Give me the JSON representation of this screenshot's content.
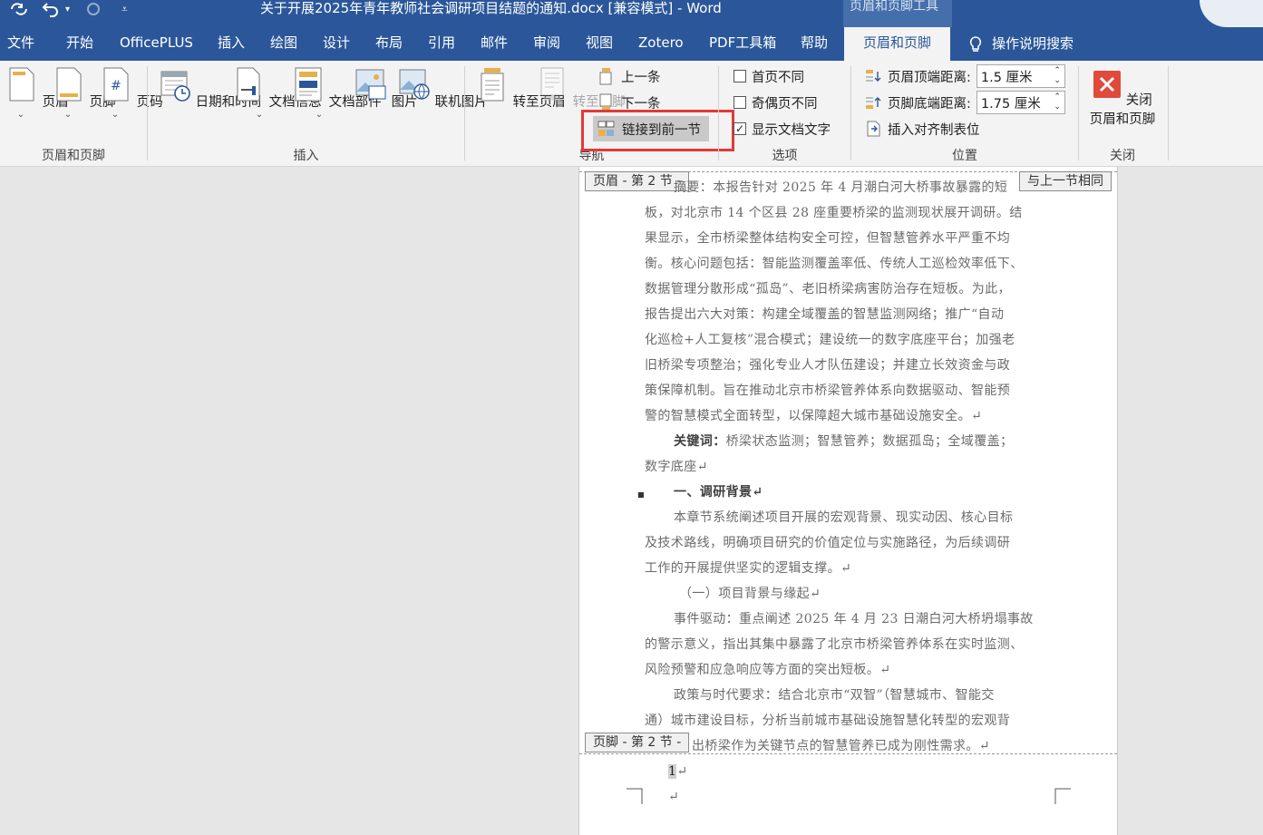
{
  "titlebar": {
    "title": "关于开展2025年青年教师社会调研项目结题的通知.docx [兼容模式]  -  Word",
    "contextual_tools": "页眉和页脚工具"
  },
  "tabs": [
    "文件",
    "开始",
    "OfficePLUS",
    "插入",
    "绘图",
    "设计",
    "布局",
    "引用",
    "邮件",
    "审阅",
    "视图",
    "Zotero",
    "PDF工具箱",
    "帮助",
    "页眉和页脚"
  ],
  "search_label": "操作说明搜索",
  "ribbon": {
    "hf_group": {
      "label": "页眉和页脚",
      "header": "页眉",
      "footer": "页脚",
      "page_number": "页码"
    },
    "insert_group": {
      "label": "插入",
      "datetime": "日期和时间",
      "docinfo": "文档信息",
      "docparts": "文档部件",
      "picture": "图片",
      "online_picture": "联机图片"
    },
    "nav_group": {
      "label": "导航",
      "goto_header": "转至页眉",
      "goto_footer": "转至页脚",
      "previous": "上一条",
      "next": "下一条",
      "link_previous": "链接到前一节"
    },
    "options_group": {
      "label": "选项",
      "different_first": "首页不同",
      "different_odd_even": "奇偶页不同",
      "show_doc_text": "显示文档文字"
    },
    "position_group": {
      "label": "位置",
      "header_from_top_label": "页眉顶端距离:",
      "header_from_top_value": "1.5 厘米",
      "footer_from_bottom_label": "页脚底端距离:",
      "footer_from_bottom_value": "1.75 厘米",
      "insert_align_tab": "插入对齐制表位"
    },
    "close_group": {
      "label": "关闭",
      "close_line1": "关闭",
      "close_line2": "页眉和页脚"
    }
  },
  "document": {
    "header_tag": "页眉 - 第 2 节 -",
    "same_as_previous": "与上一节相同",
    "footer_tag": "页脚 - 第 2 节 -",
    "page_number": "1",
    "lines": [
      "摘要：本报告针对 2025 年 4 月潮白河大桥事故暴露的短",
      "板，对北京市 14 个区县 28 座重要桥梁的监测现状展开调研。结",
      "果显示，全市桥梁整体结构安全可控，但智慧管养水平严重不均",
      "衡。核心问题包括：智能监测覆盖率低、传统人工巡检效率低下、",
      "数据管理分散形成“孤岛”、老旧桥梁病害防治存在短板。为此，",
      "报告提出六大对策：构建全域覆盖的智慧监测网络；推广“自动",
      "化巡检+人工复核”混合模式；建设统一的数字底座平台；加强老",
      "旧桥梁专项整治；强化专业人才队伍建设；并建立长效资金与政",
      "策保障机制。旨在推动北京市桥梁管养体系向数据驱动、智能预",
      "警的智慧模式全面转型，以保障超大城市基础设施安全。↵"
    ],
    "keywords_label": "关键词：",
    "keywords_text": "桥梁状态监测；智慧管养；数据孤岛；全域覆盖；",
    "keywords_cont": "数字底座↵",
    "section1_heading": "一、调研背景↵",
    "section1_lines": [
      "本章节系统阐述项目开展的宏观背景、现实动因、核心目标",
      "及技术路线，明确项目研究的价值定位与实施路径，为后续调研",
      "工作的开展提供坚实的逻辑支撑。↵"
    ],
    "subsection1": "（一）项目背景与缘起↵",
    "event_lines": [
      "事件驱动：重点阐述 2025 年 4 月 23 日潮白河大桥坍塌事故",
      "的警示意义，指出其集中暴露了北京市桥梁管养体系在实时监测、",
      "风险预警和应急响应等方面的突出短板。↵"
    ],
    "policy_lines": [
      "政策与时代要求：结合北京市“双智”（智慧城市、智能交",
      "通）城市建设目标，分析当前城市基础设施智慧化转型的宏观背",
      "出桥梁作为关键节点的智慧管养已成为刚性需求。↵"
    ],
    "empty_para": "↵"
  },
  "colors": {
    "brand": "#2b579a",
    "highlight": "#e53935",
    "close_red": "#e04a3a"
  }
}
